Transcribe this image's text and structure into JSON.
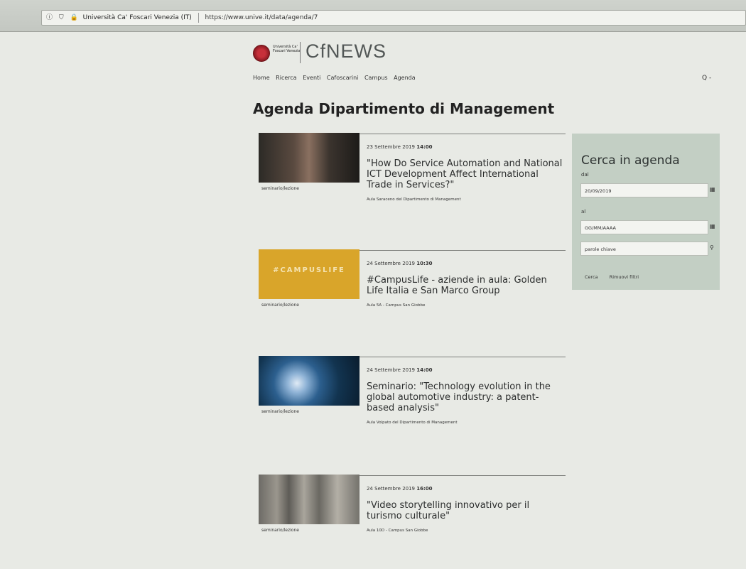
{
  "browser": {
    "site_identity": "Università Ca' Foscari Venezia (IT)",
    "url": "https://www.unive.it/data/agenda/7"
  },
  "header": {
    "university_name": "Università Ca' Foscari Venezia",
    "brand": "CfNEWS",
    "nav": [
      "Home",
      "Ricerca",
      "Eventi",
      "Cafoscarini",
      "Campus",
      "Agenda"
    ],
    "search_toggle": "Q -"
  },
  "page_title": "Agenda Dipartimento di Management",
  "events": [
    {
      "thumb_caption": "seminario/lezione",
      "date": "23 Settembre 2019",
      "time": "14:00",
      "title": "\"How Do Service Automation and National ICT Development Affect International Trade in Services?\"",
      "location": "Aula Saraceno del Dipartimento di Management"
    },
    {
      "thumb_caption": "seminario/lezione",
      "thumb_text": "#CAMPUSLIFE",
      "date": "24 Settembre 2019",
      "time": "10:30",
      "title": "#CampusLife - aziende in aula: Golden Life Italia e San Marco Group",
      "location": "Aula 5A - Campus San Giobbe"
    },
    {
      "thumb_caption": "seminario/lezione",
      "date": "24 Settembre 2019",
      "time": "14:00",
      "title": "Seminario: \"Technology evolution in the global automotive industry: a patent-based analysis\"",
      "location": "Aula Volpato del Dipartimento di Management"
    },
    {
      "thumb_caption": "seminario/lezione",
      "date": "24 Settembre 2019",
      "time": "16:00",
      "title": "\"Video storytelling innovativo per il turismo culturale\"",
      "location": "Aula 10D - Campus San Giobbe"
    }
  ],
  "sidebar": {
    "title": "Cerca in agenda",
    "from_label": "dal",
    "from_value": "20/09/2019",
    "to_label": "al",
    "to_placeholder": "GG/MM/AAAA",
    "keywords_placeholder": "parole chiave",
    "search_label": "Cerca",
    "reset_label": "Rimuovi filtri"
  }
}
